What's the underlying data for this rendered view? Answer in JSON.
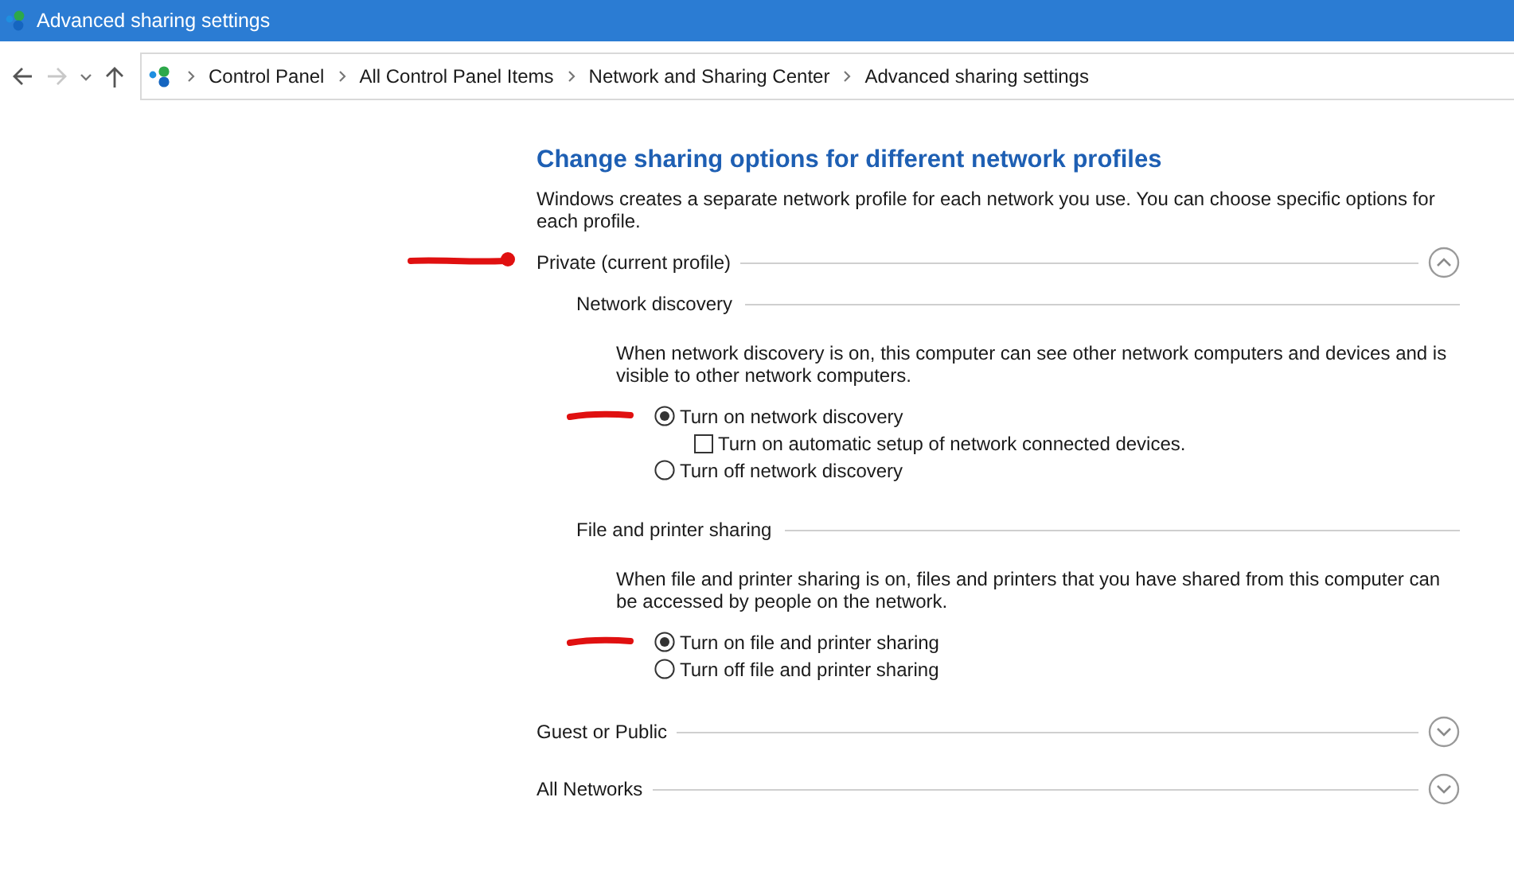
{
  "window": {
    "title": "Advanced sharing settings"
  },
  "breadcrumb": [
    "Control Panel",
    "All Control Panel Items",
    "Network and Sharing Center",
    "Advanced sharing settings"
  ],
  "heading": "Change sharing options for different network profiles",
  "intro": "Windows creates a separate network profile for each network you use. You can choose specific options for each profile.",
  "profiles": [
    {
      "title": "Private (current profile)",
      "expanded": true,
      "marked": true,
      "sections": [
        {
          "title": "Network discovery",
          "description": "When network discovery is on, this computer can see other network computers and devices and is visible to other network computers.",
          "options": [
            {
              "kind": "radio",
              "label": "Turn on network discovery",
              "selected": true,
              "marked": true,
              "children": [
                {
                  "kind": "checkbox",
                  "label": "Turn on automatic setup of network connected devices.",
                  "checked": false,
                  "marked": false
                }
              ]
            },
            {
              "kind": "radio",
              "label": "Turn off network discovery",
              "selected": false,
              "marked": false
            }
          ]
        },
        {
          "title": "File and printer sharing",
          "description": "When file and printer sharing is on, files and printers that you have shared from this computer can be accessed by people on the network.",
          "options": [
            {
              "kind": "radio",
              "label": "Turn on file and printer sharing",
              "selected": true,
              "marked": true
            },
            {
              "kind": "radio",
              "label": "Turn off file and printer sharing",
              "selected": false,
              "marked": false
            }
          ]
        }
      ]
    },
    {
      "title": "Guest or Public",
      "expanded": false,
      "marked": false
    },
    {
      "title": "All Networks",
      "expanded": false,
      "marked": false
    }
  ]
}
